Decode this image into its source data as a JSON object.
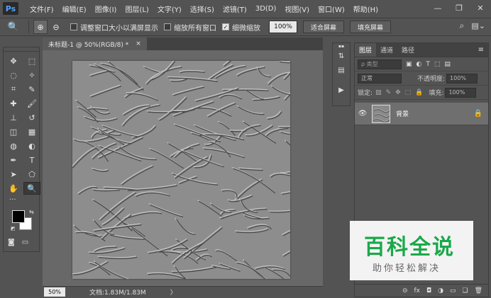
{
  "app": {
    "logo": "Ps"
  },
  "menu": [
    "文件(F)",
    "编辑(E)",
    "图像(I)",
    "图层(L)",
    "文字(Y)",
    "选择(S)",
    "滤镜(T)",
    "3D(D)",
    "视图(V)",
    "窗口(W)",
    "帮助(H)"
  ],
  "window_controls": {
    "minimize": "—",
    "restore": "❐",
    "close": "✕"
  },
  "options": {
    "tool_glyph": "🔍",
    "zoom_in": "⊕",
    "zoom_out": "⊖",
    "resize_windows_label": "调整窗口大小以满屏显示",
    "resize_windows_checked": false,
    "zoom_all_label": "缩放所有窗口",
    "zoom_all_checked": false,
    "scrubby_zoom_label": "细微缩放",
    "scrubby_zoom_checked": true,
    "zoom_value": "100%",
    "fit_screen_label": "适合屏幕",
    "fill_screen_label": "填充屏幕"
  },
  "tools": [
    {
      "name": "move-tool",
      "glyph": "✥"
    },
    {
      "name": "marquee-tool",
      "glyph": "⬚"
    },
    {
      "name": "lasso-tool",
      "glyph": "◌"
    },
    {
      "name": "magic-wand-tool",
      "glyph": "✧"
    },
    {
      "name": "crop-tool",
      "glyph": "⌗"
    },
    {
      "name": "eyedropper-tool",
      "glyph": "✎"
    },
    {
      "name": "healing-tool",
      "glyph": "✚"
    },
    {
      "name": "brush-tool",
      "glyph": "🖌"
    },
    {
      "name": "stamp-tool",
      "glyph": "⊥"
    },
    {
      "name": "history-brush-tool",
      "glyph": "↺"
    },
    {
      "name": "eraser-tool",
      "glyph": "◫"
    },
    {
      "name": "gradient-tool",
      "glyph": "▦"
    },
    {
      "name": "blur-tool",
      "glyph": "◍"
    },
    {
      "name": "dodge-tool",
      "glyph": "◐"
    },
    {
      "name": "pen-tool",
      "glyph": "✒"
    },
    {
      "name": "type-tool",
      "glyph": "T"
    },
    {
      "name": "path-select-tool",
      "glyph": "➤"
    },
    {
      "name": "shape-tool",
      "glyph": "⬠"
    },
    {
      "name": "hand-tool",
      "glyph": "✋"
    },
    {
      "name": "zoom-tool",
      "glyph": "🔍"
    }
  ],
  "toolbox_extra": {
    "more": "···",
    "swap": "⇆",
    "reset": "◩",
    "quickmask": "◙",
    "screenmode": "▭"
  },
  "document": {
    "tab_title": "未标题-1 @ 50%(RGB/8) *",
    "tab_close": "×",
    "status_zoom": "50%",
    "status_info": "文档:1.83M/1.83M",
    "status_arrow": "〉"
  },
  "iconcol": [
    "⇅",
    "▤",
    "▶"
  ],
  "layers_panel": {
    "tabs": [
      "图层",
      "通道",
      "路径"
    ],
    "menu": "≡",
    "filter_placeholder": "ρ 类型",
    "filter_icons": [
      "▣",
      "◐",
      "T",
      "⬚",
      "▤"
    ],
    "blend_mode": "正常",
    "opacity_label": "不透明度:",
    "opacity_value": "100%",
    "lock_label": "锁定:",
    "lock_icons": [
      "▨",
      "✎",
      "✥",
      "⬚",
      "🔒"
    ],
    "fill_label": "填充:",
    "fill_value": "100%",
    "layer": {
      "eye": "👁",
      "name": "背景",
      "lock": "🔒"
    },
    "footer_icons": [
      "⊝",
      "fx",
      "◘",
      "◑",
      "▭",
      "❏",
      "🗑"
    ]
  },
  "watermark": {
    "title": "百科全说",
    "subtitle": "助你轻松解决"
  }
}
